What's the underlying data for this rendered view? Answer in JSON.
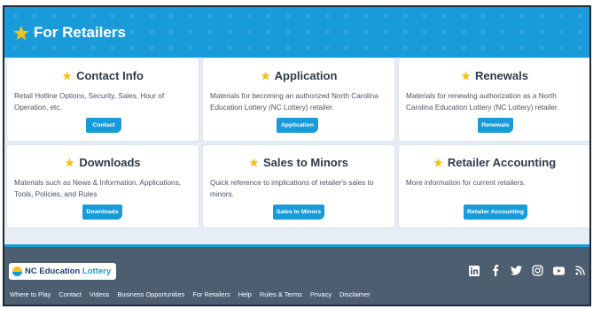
{
  "banner": {
    "title": "For Retailers"
  },
  "cards": [
    {
      "title": "Contact Info",
      "description": "Retail Hotline Options, Security, Sales, Hour of Operation, etc.",
      "button": "Contact"
    },
    {
      "title": "Application",
      "description": "Materials for becoming an authorized North Carolina Education Lottery (NC Lottery) retailer.",
      "button": "Application"
    },
    {
      "title": "Renewals",
      "description": "Materials for renewing authorization as a North Carolina Education Lottery (NC Lottery) retailer.",
      "button": "Renewals"
    },
    {
      "title": "Downloads",
      "description": "Materials such as News & Information, Applications, Tools, Policies, and Rules",
      "button": "Downloads"
    },
    {
      "title": "Sales to Minors",
      "description": "Quick reference to implications of retailer's sales to minors.",
      "button": "Sales to Minors"
    },
    {
      "title": "Retailer Accounting",
      "description": "More information for current retailers.",
      "button": "Retailer Accounting"
    }
  ],
  "footer": {
    "logo_main": "NC Education",
    "logo_accent": "Lottery",
    "links": [
      "Where to Play",
      "Contact",
      "Videos",
      "Business Opportunities",
      "For Retailers",
      "Help",
      "Rules & Terms",
      "Privacy",
      "Disclaimer"
    ],
    "socials": [
      "linkedin-icon",
      "facebook-icon",
      "twitter-icon",
      "instagram-icon",
      "youtube-icon",
      "rss-icon"
    ]
  },
  "colors": {
    "brand_blue": "#1a9bd9",
    "star_yellow": "#f7c11c",
    "footer_bg": "#4c5e70",
    "page_bg": "#e6edf4"
  }
}
